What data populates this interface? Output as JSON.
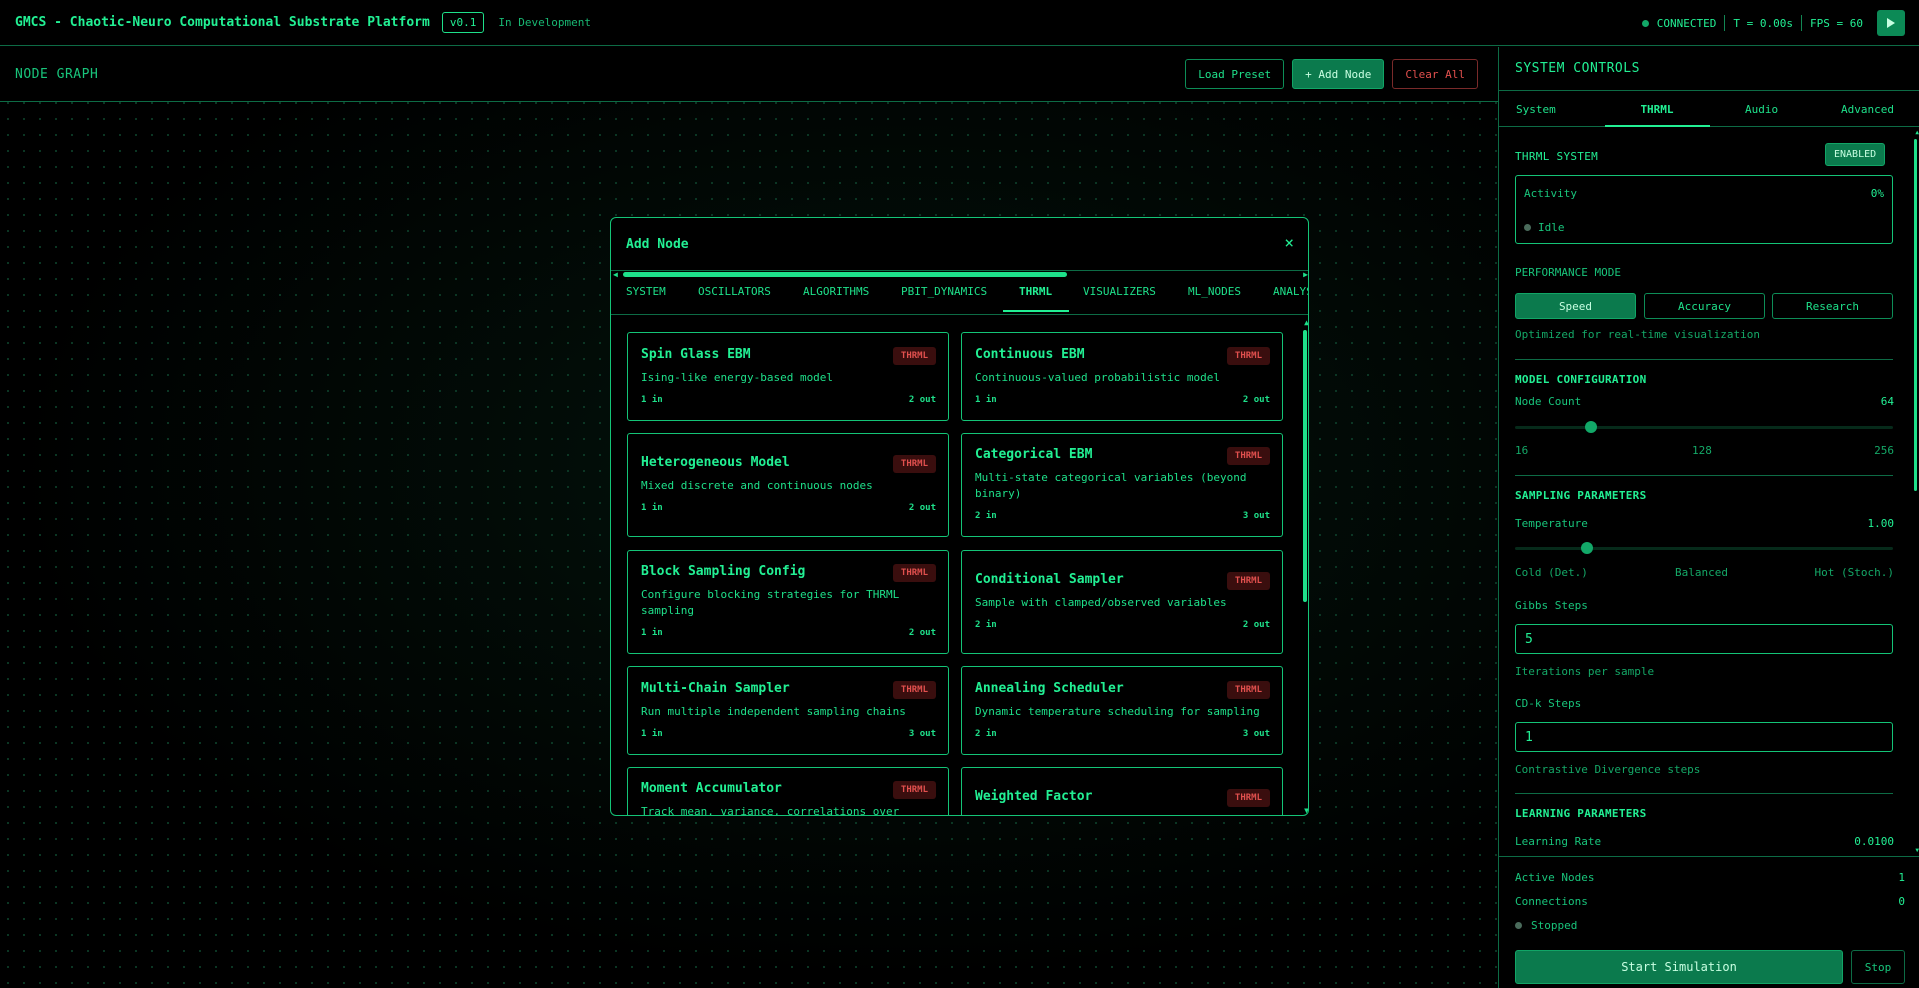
{
  "header": {
    "title": "GMCS - Chaotic-Neuro Computational Substrate Platform",
    "version": "v0.1",
    "status": "In Development",
    "connection": "CONNECTED",
    "time": "T = 0.00s",
    "fps": "FPS = 60"
  },
  "graph": {
    "title": "NODE GRAPH",
    "load_preset": "Load Preset",
    "add_node": "+ Add Node",
    "clear_all": "Clear All"
  },
  "modal": {
    "title": "Add Node",
    "close": "×",
    "tabs": [
      "SYSTEM",
      "OSCILLATORS",
      "ALGORITHMS",
      "PBIT_DYNAMICS",
      "THRML",
      "VISUALIZERS",
      "ML_NODES",
      "ANALYS"
    ],
    "active_tab": "THRML",
    "cards": [
      {
        "name": "Spin Glass EBM",
        "tag": "THRML",
        "desc": "Ising-like energy-based model",
        "in": "1 in",
        "out": "2 out"
      },
      {
        "name": "Continuous EBM",
        "tag": "THRML",
        "desc": "Continuous-valued probabilistic model",
        "in": "1 in",
        "out": "2 out"
      },
      {
        "name": "Heterogeneous Model",
        "tag": "THRML",
        "desc": "Mixed discrete and continuous nodes",
        "in": "1 in",
        "out": "2 out"
      },
      {
        "name": "Categorical EBM",
        "tag": "THRML",
        "desc": "Multi-state categorical variables (beyond binary)",
        "in": "2 in",
        "out": "3 out"
      },
      {
        "name": "Block Sampling Config",
        "tag": "THRML",
        "desc": "Configure blocking strategies for THRML sampling",
        "in": "1 in",
        "out": "2 out"
      },
      {
        "name": "Conditional Sampler",
        "tag": "THRML",
        "desc": "Sample with clamped/observed variables",
        "in": "2 in",
        "out": "2 out"
      },
      {
        "name": "Multi-Chain Sampler",
        "tag": "THRML",
        "desc": "Run multiple independent sampling chains",
        "in": "1 in",
        "out": "3 out"
      },
      {
        "name": "Annealing Scheduler",
        "tag": "THRML",
        "desc": "Dynamic temperature scheduling for sampling",
        "in": "2 in",
        "out": "3 out"
      },
      {
        "name": "Moment Accumulator",
        "tag": "THRML",
        "desc": "Track mean, variance, correlations over",
        "in": "",
        "out": ""
      },
      {
        "name": "Weighted Factor",
        "tag": "THRML",
        "desc": "",
        "in": "",
        "out": ""
      }
    ]
  },
  "panel": {
    "title": "SYSTEM CONTROLS",
    "tabs": [
      "System",
      "THRML",
      "Audio",
      "Advanced"
    ],
    "active_tab": "THRML",
    "thrml_system": "THRML SYSTEM",
    "enabled": "ENABLED",
    "activity_label": "Activity",
    "activity_value": "0%",
    "activity_state": "Idle",
    "performance_mode": "PERFORMANCE MODE",
    "modes": [
      "Speed",
      "Accuracy",
      "Research"
    ],
    "active_mode": "Speed",
    "mode_hint": "Optimized for real-time visualization",
    "model_config": "MODEL CONFIGURATION",
    "node_count_label": "Node Count",
    "node_count_value": 64,
    "node_count_ticks": [
      "16",
      "128",
      "256"
    ],
    "node_count_fraction": 0.2,
    "sampling": "SAMPLING PARAMETERS",
    "temperature_label": "Temperature",
    "temperature_value": "1.00",
    "temperature_ticks": [
      "Cold (Det.)",
      "Balanced",
      "Hot (Stoch.)"
    ],
    "temperature_fraction": 0.19,
    "gibbs_label": "Gibbs Steps",
    "gibbs_value": "5",
    "gibbs_hint": "Iterations per sample",
    "cdk_label": "CD-k Steps",
    "cdk_value": "1",
    "cdk_hint": "Contrastive Divergence steps",
    "learning": "LEARNING PARAMETERS",
    "learning_rate_label": "Learning Rate",
    "learning_rate_value": "0.0100",
    "active_nodes_label": "Active Nodes",
    "active_nodes_value": "1",
    "connections_label": "Connections",
    "connections_value": "0",
    "run_state": "Stopped",
    "start": "Start Simulation",
    "stop": "Stop"
  },
  "colors": {
    "accent": "#1ee08a",
    "button_bg": "#0b7a4d",
    "danger": "#e2504e",
    "tag_bg": "#3a0e0e"
  }
}
